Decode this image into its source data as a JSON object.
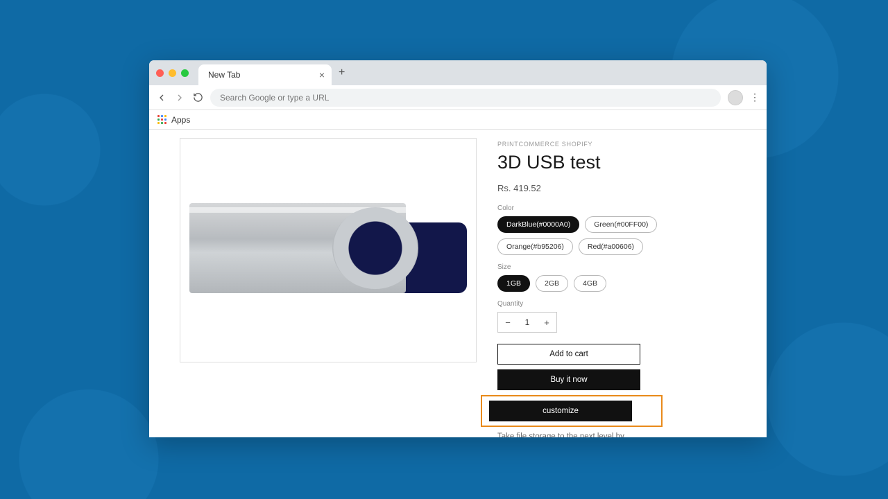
{
  "browser": {
    "tab_title": "New Tab",
    "url_placeholder": "Search Google or type a URL",
    "apps_label": "Apps"
  },
  "product": {
    "vendor": "PRINTCOMMERCE SHOPIFY",
    "title": "3D USB test",
    "price": "Rs. 419.52",
    "color_label": "Color",
    "colors": [
      "DarkBlue(#0000A0)",
      "Green(#00FF00)",
      "Orange(#b95206)",
      "Red(#a00606)"
    ],
    "size_label": "Size",
    "sizes": [
      "1GB",
      "2GB",
      "4GB"
    ],
    "quantity_label": "Quantity",
    "quantity_value": "1",
    "add_to_cart": "Add to cart",
    "buy_now": "Buy it now",
    "customize": "customize",
    "description": "Take file storage to the next level by distributing these innovative USB drives to those on your marketing list. The cards feature a rigid plastic"
  },
  "apps_colors": [
    "#ea4335",
    "#4285f4",
    "#fbbc05",
    "#34a853",
    "#ea4335",
    "#4285f4",
    "#fbbc05",
    "#34a853",
    "#ea4335"
  ]
}
